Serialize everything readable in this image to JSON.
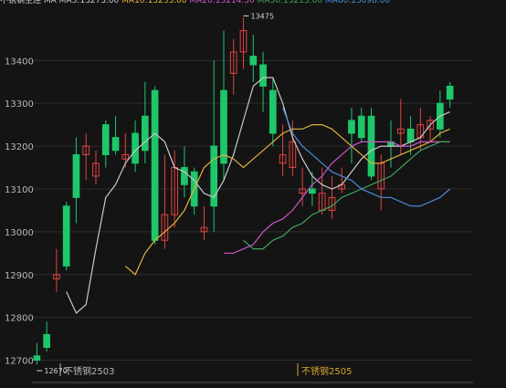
{
  "chart_data": {
    "type": "candlestick",
    "title": "",
    "legend_prefix": "不锈钢主连",
    "legend": [
      {
        "name": "MA",
        "text": "MA MA5:13273.00",
        "color": "#c8c8c8"
      },
      {
        "name": "MA10",
        "text": "MA10:13233.00",
        "color": "#e2b13c"
      },
      {
        "name": "MA20",
        "text": "MA20:13214.50",
        "color": "#cc55cc"
      },
      {
        "name": "MA30",
        "text": "MA30:13213.00",
        "color": "#3fa35c"
      },
      {
        "name": "MA60",
        "text": "MA60:13098.00",
        "color": "#4a8fd9"
      }
    ],
    "ylim": [
      12650,
      13520
    ],
    "yticks": [
      12700,
      12800,
      12900,
      13000,
      13100,
      13200,
      13300,
      13400
    ],
    "grid": true,
    "candles": [
      [
        12710,
        12700,
        12740,
        12690
      ],
      [
        12760,
        12730,
        12790,
        12720
      ],
      [
        12890,
        12900,
        12960,
        12860
      ],
      [
        13060,
        12920,
        13070,
        12910
      ],
      [
        13180,
        13080,
        13220,
        13020
      ],
      [
        13180,
        13200,
        13230,
        13120
      ],
      [
        13130,
        13160,
        13190,
        13110
      ],
      [
        13250,
        13180,
        13260,
        13150
      ],
      [
        13220,
        13190,
        13270,
        13180
      ],
      [
        13170,
        13180,
        13230,
        13150
      ],
      [
        13230,
        13160,
        13260,
        13140
      ],
      [
        13270,
        13190,
        13350,
        13160
      ],
      [
        13330,
        12980,
        13340,
        12970
      ],
      [
        12980,
        13040,
        13180,
        12960
      ],
      [
        13040,
        13150,
        13190,
        13010
      ],
      [
        13150,
        13110,
        13200,
        13080
      ],
      [
        13140,
        13060,
        13150,
        13040
      ],
      [
        13000,
        13010,
        13060,
        12980
      ],
      [
        13200,
        13060,
        13400,
        13000
      ],
      [
        13330,
        13160,
        13470,
        13120
      ],
      [
        13370,
        13420,
        13450,
        13320
      ],
      [
        13420,
        13470,
        13500,
        13380
      ],
      [
        13410,
        13390,
        13460,
        13350
      ],
      [
        13390,
        13340,
        13420,
        13280
      ],
      [
        13330,
        13230,
        13360,
        13200
      ],
      [
        13160,
        13180,
        13250,
        13130
      ],
      [
        13150,
        13210,
        13260,
        13130
      ],
      [
        13090,
        13100,
        13150,
        13060
      ],
      [
        13100,
        13090,
        13140,
        13060
      ],
      [
        13050,
        13090,
        13150,
        13040
      ],
      [
        13050,
        13080,
        13130,
        13030
      ],
      [
        13100,
        13110,
        13150,
        13090
      ],
      [
        13260,
        13230,
        13290,
        13160
      ],
      [
        13270,
        13220,
        13290,
        13210
      ],
      [
        13270,
        13130,
        13290,
        13120
      ],
      [
        13100,
        13160,
        13180,
        13050
      ],
      [
        13210,
        13200,
        13260,
        13150
      ],
      [
        13230,
        13240,
        13310,
        13180
      ],
      [
        13240,
        13210,
        13270,
        13180
      ],
      [
        13220,
        13250,
        13290,
        13190
      ],
      [
        13240,
        13260,
        13270,
        13210
      ],
      [
        13300,
        13240,
        13330,
        13220
      ],
      [
        13340,
        13310,
        13350,
        13290
      ]
    ],
    "series": [
      {
        "name": "MA5",
        "values": [
          12860,
          12810,
          12830,
          12960,
          13080,
          13110,
          13160,
          13190,
          13210,
          13230,
          13210,
          13150,
          13140,
          13120,
          13090,
          13080,
          13120,
          13180,
          13260,
          13340,
          13360,
          13360,
          13300,
          13220,
          13170,
          13130,
          13110,
          13100,
          13110,
          13140,
          13170,
          13190,
          13200,
          13200,
          13200,
          13210,
          13220,
          13250,
          13270,
          13280
        ]
      },
      {
        "name": "MA10",
        "values": [
          12920,
          12900,
          12950,
          12980,
          13000,
          13020,
          13050,
          13100,
          13150,
          13170,
          13180,
          13170,
          13150,
          13170,
          13190,
          13210,
          13230,
          13240,
          13240,
          13250,
          13250,
          13240,
          13220,
          13200,
          13180,
          13160,
          13160,
          13170,
          13180,
          13190,
          13200,
          13210,
          13230,
          13240
        ]
      },
      {
        "name": "MA20",
        "values": [
          12950,
          12950,
          12960,
          12970,
          13000,
          13020,
          13030,
          13050,
          13080,
          13110,
          13130,
          13160,
          13180,
          13200,
          13210,
          13210,
          13210,
          13210,
          13200,
          13200,
          13210,
          13210,
          13210,
          13210
        ]
      },
      {
        "name": "MA30",
        "values": [
          12980,
          12960,
          12960,
          12980,
          12990,
          13010,
          13020,
          13040,
          13050,
          13060,
          13080,
          13090,
          13100,
          13110,
          13120,
          13130,
          13150,
          13170,
          13190,
          13200,
          13210,
          13210
        ]
      },
      {
        "name": "MA60",
        "values": [
          13290,
          13230,
          13200,
          13180,
          13160,
          13140,
          13130,
          13120,
          13100,
          13090,
          13080,
          13080,
          13070,
          13060,
          13060,
          13070,
          13080,
          13100
        ]
      }
    ],
    "annotations": [
      {
        "text": "13475",
        "kind": "max"
      },
      {
        "text": "12670",
        "kind": "min"
      }
    ],
    "contracts": [
      {
        "label": "不锈钢2503",
        "color": "#b8b8b8"
      },
      {
        "label": "不锈钢2505",
        "color": "#d9a430"
      }
    ]
  },
  "colors": {
    "up": "#e0443f",
    "down": "#1ec76a",
    "grid": "#2c2c2c"
  }
}
